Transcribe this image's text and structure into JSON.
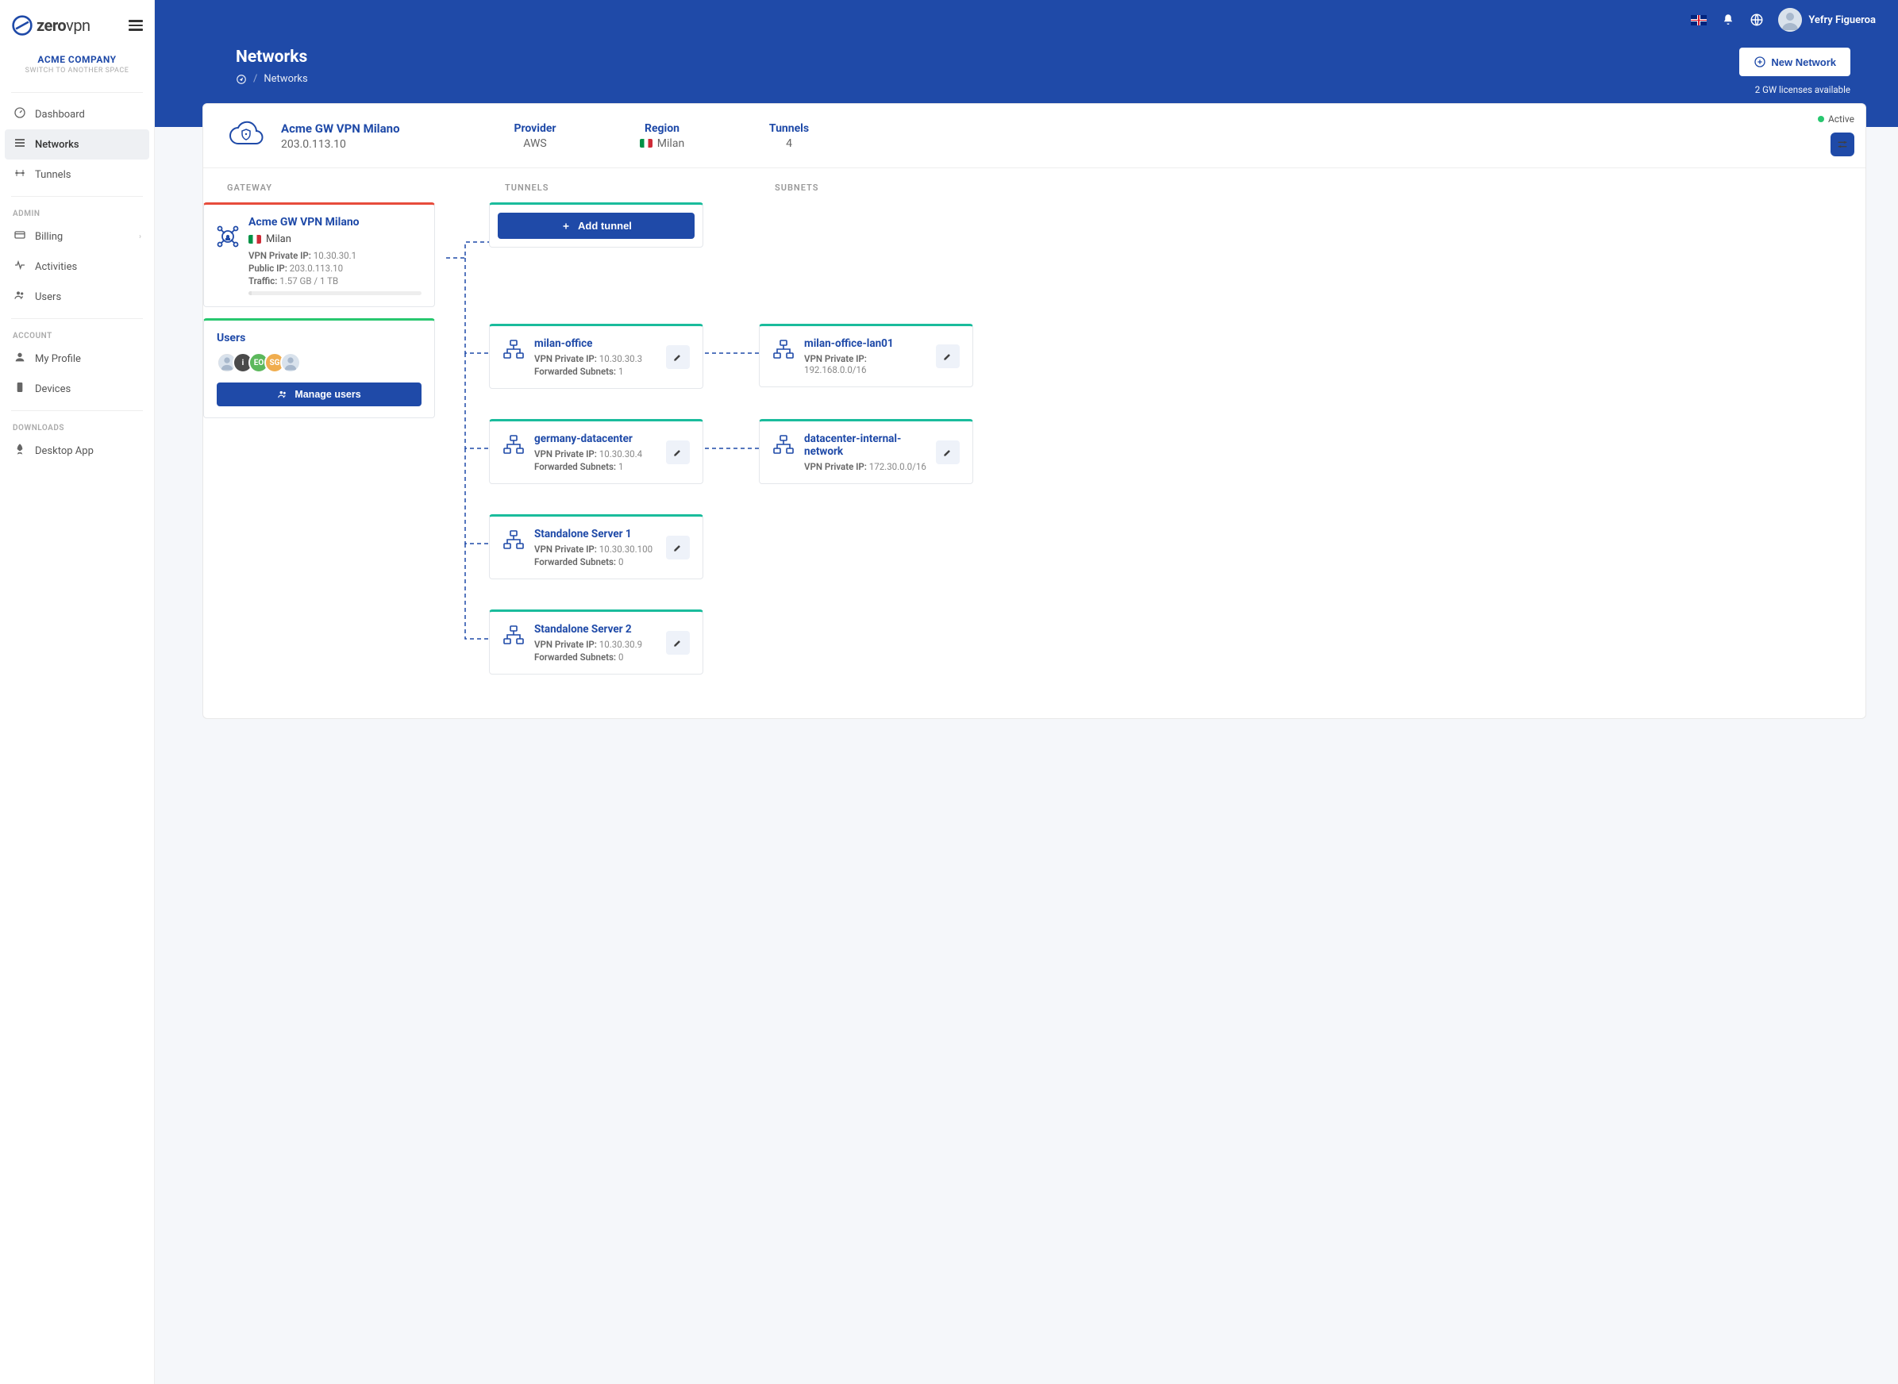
{
  "brand": {
    "name_bold": "zero",
    "name_light": "vpn"
  },
  "company": {
    "name": "ACME COMPANY",
    "switch_label": "SWITCH TO ANOTHER SPACE"
  },
  "nav": {
    "main": [
      {
        "label": "Dashboard",
        "icon": "gauge"
      },
      {
        "label": "Networks",
        "icon": "list"
      },
      {
        "label": "Tunnels",
        "icon": "tunnel"
      }
    ],
    "admin_heading": "ADMIN",
    "admin": [
      {
        "label": "Billing",
        "icon": "card",
        "chevron": true
      },
      {
        "label": "Activities",
        "icon": "heart"
      },
      {
        "label": "Users",
        "icon": "users"
      }
    ],
    "account_heading": "ACCOUNT",
    "account": [
      {
        "label": "My Profile",
        "icon": "person"
      },
      {
        "label": "Devices",
        "icon": "device"
      }
    ],
    "downloads_heading": "DOWNLOADS",
    "downloads": [
      {
        "label": "Desktop App",
        "icon": "rocket"
      }
    ]
  },
  "topbar": {
    "user_name": "Yefry Figueroa"
  },
  "header": {
    "title": "Networks",
    "breadcrumb_current": "Networks",
    "new_btn": "New Network",
    "license_note": "2 GW licenses available"
  },
  "gateway_summary": {
    "name": "Acme GW VPN Milano",
    "ip": "203.0.113.10",
    "provider_label": "Provider",
    "provider": "AWS",
    "region_label": "Region",
    "region": "Milan",
    "tunnels_label": "Tunnels",
    "tunnels_count": "4",
    "status": "Active"
  },
  "columns": {
    "gateway": "GATEWAY",
    "tunnels": "TUNNELS",
    "subnets": "SUBNETS"
  },
  "gateway_card": {
    "name": "Acme GW VPN Milano",
    "location": "Milan",
    "private_ip_label": "VPN Private IP:",
    "private_ip": "10.30.30.1",
    "public_ip_label": "Public IP:",
    "public_ip": "203.0.113.10",
    "traffic_label": "Traffic:",
    "traffic": "1.57 GB / 1 TB"
  },
  "users_card": {
    "title": "Users",
    "manage_btn": "Manage users",
    "avatars": [
      "",
      "i",
      "EO",
      "SG",
      ""
    ]
  },
  "add_tunnel_btn": "Add tunnel",
  "tunnels": [
    {
      "name": "milan-office",
      "private_ip": "10.30.30.3",
      "subnets": "1"
    },
    {
      "name": "germany-datacenter",
      "private_ip": "10.30.30.4",
      "subnets": "1"
    },
    {
      "name": "Standalone Server 1",
      "private_ip": "10.30.30.100",
      "subnets": "0"
    },
    {
      "name": "Standalone Server 2",
      "private_ip": "10.30.30.9",
      "subnets": "0"
    }
  ],
  "tunnel_labels": {
    "private_ip": "VPN Private IP:",
    "subnets": "Forwarded Subnets:"
  },
  "subnets": [
    {
      "name": "milan-office-lan01",
      "private_ip": "192.168.0.0/16"
    },
    {
      "name": "datacenter-internal-network",
      "private_ip": "172.30.0.0/16"
    }
  ],
  "subnet_labels": {
    "private_ip": "VPN Private IP:"
  }
}
